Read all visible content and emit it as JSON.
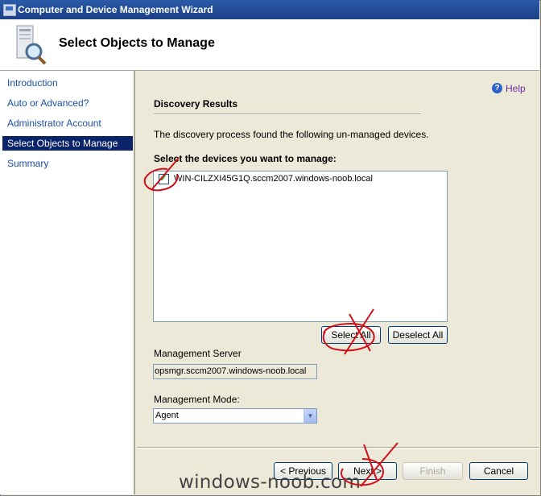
{
  "window": {
    "title": "Computer and Device Management Wizard"
  },
  "header": {
    "title": "Select Objects to Manage"
  },
  "sidebar": {
    "items": [
      {
        "label": "Introduction",
        "active": false
      },
      {
        "label": "Auto or Advanced?",
        "active": false
      },
      {
        "label": "Administrator Account",
        "active": false
      },
      {
        "label": "Select Objects to Manage",
        "active": true
      },
      {
        "label": "Summary",
        "active": false
      }
    ]
  },
  "help": {
    "label": "Help"
  },
  "discovery": {
    "section_title": "Discovery Results",
    "description": "The discovery process found the following un-managed devices.",
    "select_label": "Select the devices you want to manage:",
    "devices": [
      {
        "name": "WIN-CILZXI45G1Q.sccm2007.windows-noob.local",
        "checked": true
      }
    ],
    "select_all_label": "Select All",
    "deselect_all_label": "Deselect All"
  },
  "management_server": {
    "label": "Management Server",
    "value": "opsmgr.sccm2007.windows-noob.local"
  },
  "management_mode": {
    "label": "Management Mode:",
    "value": "Agent"
  },
  "footer": {
    "previous_label": "< Previous",
    "next_label": "Next >",
    "finish_label": "Finish",
    "cancel_label": "Cancel"
  },
  "watermark": "windows-noob.com",
  "colors": {
    "accent": "#0a246a",
    "link": "#1c50a8",
    "annotation": "#d0101a"
  }
}
